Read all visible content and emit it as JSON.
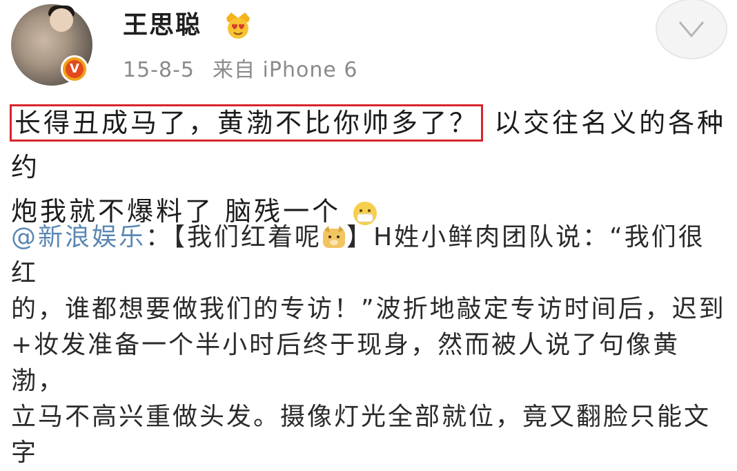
{
  "post": {
    "author": {
      "name": "王思聪",
      "vip_icon": "crown-heart-eyes-icon",
      "verified_badge": "V"
    },
    "meta": {
      "date": "15-8-5",
      "source": "来自 iPhone 6"
    },
    "content": {
      "highlighted": "长得丑成马了，黄渤不比你帅多了？",
      "rest_line1": "以交往名义的各种约",
      "line2": "炮我就不爆料了  脑残一个",
      "emoji_name": "mask-face-icon"
    },
    "repost": {
      "mention": "@新浪娱乐",
      "colon": "：",
      "topic_open": "【我们红着呢",
      "topic_emoji": "doge-icon",
      "topic_close": "】",
      "line1_tail": "H姓小鲜肉团队说：“我们很红",
      "line2": "的，谁都想要做我们的专访！”波折地敲定专访时间后，迟到",
      "line3": "+妆发准备一个半小时后终于现身，然而被人说了句像黄渤，",
      "line4": "立马不高兴重做头发。摄像灯光全部就位，竟又翻脸只能文字"
    },
    "colors": {
      "highlight_border": "#d8242c",
      "mention": "#5a87b3",
      "meta_text": "#8a8a8a"
    }
  }
}
